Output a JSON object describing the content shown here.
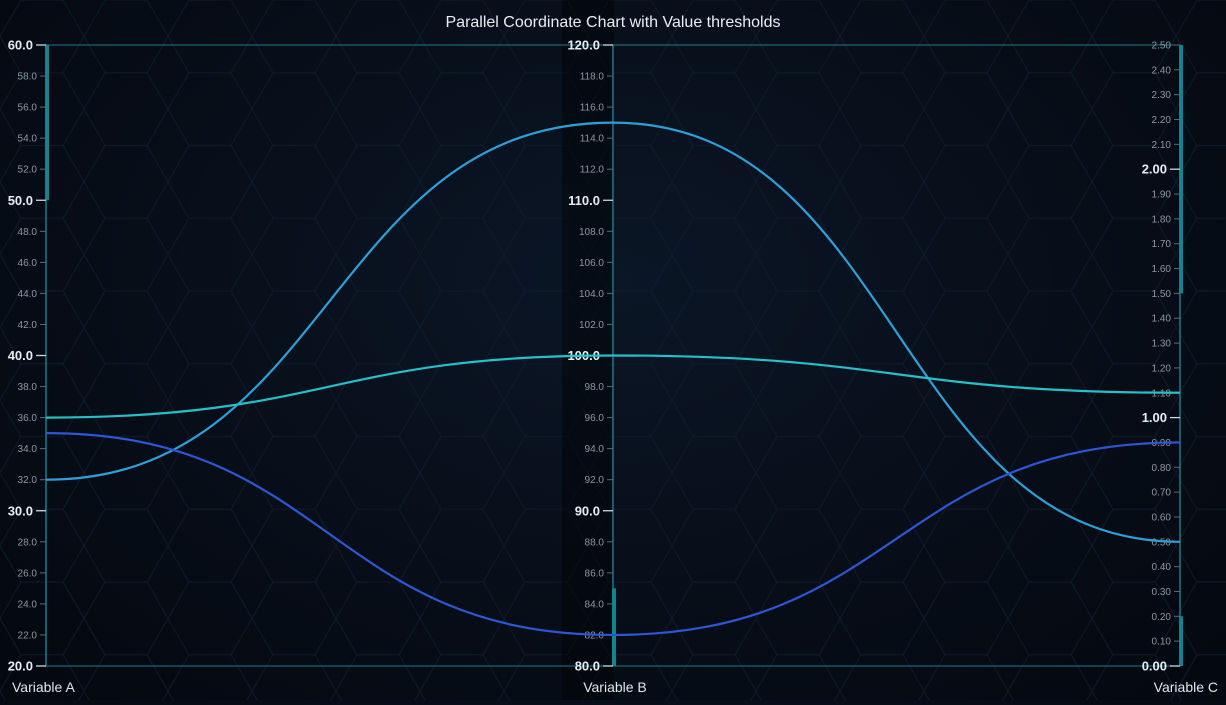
{
  "chart_data": {
    "type": "line",
    "title": "Parallel Coordinate Chart with Value thresholds",
    "axes": [
      {
        "name": "Variable A",
        "range": [
          20,
          60
        ],
        "major_ticks": [
          "20.0",
          "30.0",
          "40.0",
          "50.0",
          "60.0"
        ],
        "minor_ticks": [
          "22.0",
          "24.0",
          "26.0",
          "28.0",
          "32.0",
          "34.0",
          "36.0",
          "38.0",
          "42.0",
          "44.0",
          "46.0",
          "48.0",
          "52.0",
          "54.0",
          "56.0",
          "58.0"
        ],
        "threshold": [
          50,
          60
        ]
      },
      {
        "name": "Variable B",
        "range": [
          80,
          120
        ],
        "major_ticks": [
          "80.0",
          "90.0",
          "100.0",
          "110.0",
          "120.0"
        ],
        "minor_ticks": [
          "82.0",
          "84.0",
          "86.0",
          "88.0",
          "92.0",
          "94.0",
          "96.0",
          "98.0",
          "102.0",
          "104.0",
          "106.0",
          "108.0",
          "112.0",
          "114.0",
          "116.0",
          "118.0"
        ],
        "threshold": [
          80,
          85
        ]
      },
      {
        "name": "Variable C",
        "range": [
          0,
          2.5
        ],
        "major_ticks": [
          "0.00",
          "1.00",
          "2.00"
        ],
        "minor_ticks": [
          "0.10",
          "0.20",
          "0.30",
          "0.40",
          "0.50",
          "0.60",
          "0.70",
          "0.80",
          "0.90",
          "1.10",
          "1.20",
          "1.30",
          "1.40",
          "1.50",
          "1.60",
          "1.70",
          "1.80",
          "1.90",
          "2.10",
          "2.20",
          "2.30",
          "2.40",
          "2.50"
        ],
        "threshold_segments": [
          [
            1.5,
            2.5
          ],
          [
            0,
            0.2
          ]
        ]
      }
    ],
    "series": [
      {
        "values": [
          32,
          115,
          0.5
        ],
        "color": "#2f9fd8"
      },
      {
        "values": [
          36,
          100,
          1.1
        ],
        "color": "#26c0c8"
      },
      {
        "values": [
          35,
          82,
          0.9
        ],
        "color": "#2f56d6"
      }
    ],
    "grid": false
  },
  "colors": {
    "axis_line": "#1d7a8a",
    "threshold": "#11848f",
    "major_text": "#e6eef5",
    "minor_text": "#8d98a3",
    "axis_label": "#dfe6ee"
  }
}
